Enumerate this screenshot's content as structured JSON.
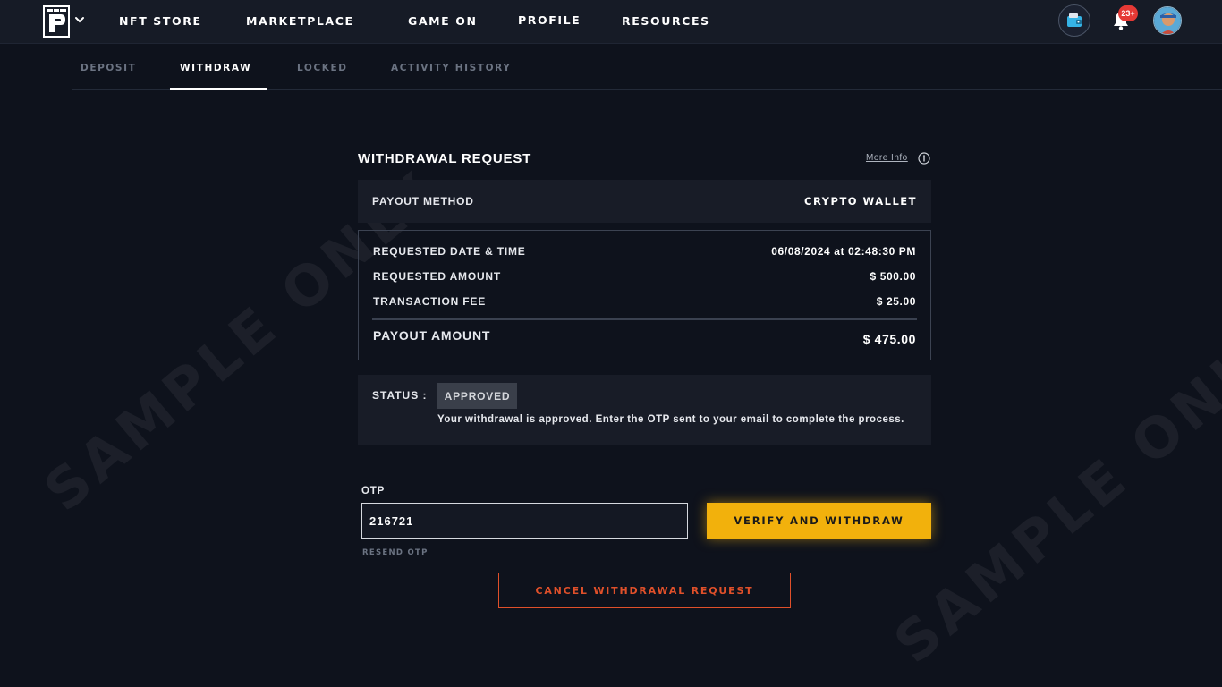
{
  "header": {
    "nav": [
      {
        "label": "NFT STORE"
      },
      {
        "label": "MARKETPLACE"
      },
      {
        "label": "GAME ON"
      },
      {
        "label": "PROFILE"
      },
      {
        "label": "RESOURCES"
      }
    ],
    "notifications_badge": "23+",
    "icons": {
      "logo": "brand-logo",
      "menu": "chevron-down-icon",
      "wallet": "wallet-icon",
      "notifications": "bell-icon",
      "avatar": "user-avatar"
    }
  },
  "tabs": [
    {
      "label": "DEPOSIT",
      "active": false
    },
    {
      "label": "WITHDRAW",
      "active": true
    },
    {
      "label": "LOCKED",
      "active": false
    },
    {
      "label": "ACTIVITY HISTORY",
      "active": false
    }
  ],
  "watermark": "SAMPLE ONLY",
  "withdrawal": {
    "title": "WITHDRAWAL REQUEST",
    "more_info": "More Info",
    "payout_method_label": "PAYOUT METHOD",
    "payout_method_value": "CRYPTO WALLET",
    "details": [
      {
        "label": "REQUESTED DATE & TIME",
        "value": "06/08/2024 at 02:48:30 PM"
      },
      {
        "label": "REQUESTED AMOUNT",
        "value": "$ 500.00"
      },
      {
        "label": "TRANSACTION FEE",
        "value": "$ 25.00"
      }
    ],
    "payout_amount_label": "PAYOUT AMOUNT",
    "payout_amount_value": "$ 475.00",
    "status_label": "STATUS :",
    "status_value": "APPROVED",
    "status_message": "Your withdrawal is approved. Enter the OTP sent to your email to complete the process."
  },
  "otp": {
    "label": "OTP",
    "value": "216721",
    "resend": "RESEND OTP"
  },
  "actions": {
    "verify": "VERIFY AND WITHDRAW",
    "cancel": "CANCEL WITHDRAWAL REQUEST"
  },
  "colors": {
    "background": "#0e121c",
    "accent_yellow": "#f2b10c",
    "cancel_orange": "#e0502a",
    "badge_red": "#e53935"
  }
}
